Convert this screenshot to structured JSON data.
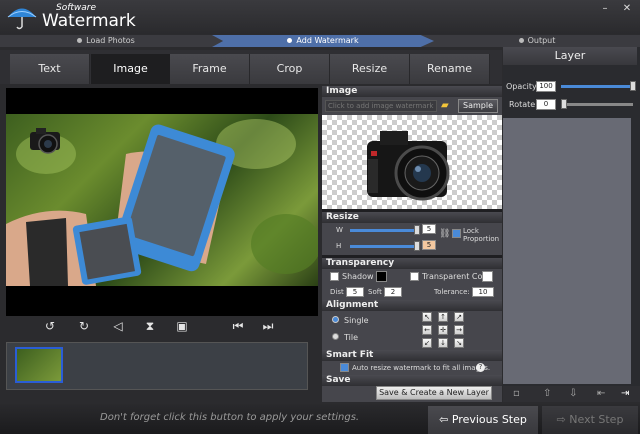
{
  "app": {
    "subtitle": "Software",
    "title": "Watermark"
  },
  "steps": [
    "Load Photos",
    "Add Watermark",
    "Output"
  ],
  "tabs": [
    "Text",
    "Image",
    "Frame",
    "Crop",
    "Resize",
    "Rename"
  ],
  "active_tab": "Image",
  "image_section": {
    "title": "Image",
    "path_placeholder": "Click to add image watermark...",
    "sample_label": "Sample"
  },
  "resize_section": {
    "title": "Resize",
    "w_label": "W",
    "h_label": "H",
    "w_value": "5",
    "h_value": "5",
    "lock_label": "Lock\nProportion"
  },
  "transparency_section": {
    "title": "Transparency",
    "shadow_label": "Shadow",
    "transparent_color_label": "Transparent Color",
    "dist_label": "Dist",
    "dist_value": "5",
    "soft_label": "Soft",
    "soft_value": "2",
    "tolerance_label": "Tolerance:",
    "tolerance_value": "10"
  },
  "alignment_section": {
    "title": "Alignment",
    "single_label": "Single",
    "tile_label": "Tile"
  },
  "smartfit_section": {
    "title": "Smart Fit",
    "auto_resize_label": "Auto resize watermark to fit all images."
  },
  "save_section": {
    "title": "Save",
    "button_label": "Save & Create a New Layer"
  },
  "layer_panel": {
    "title": "Layer",
    "opacity_label": "Opacity",
    "opacity_value": "100",
    "rotate_label": "Rotate",
    "rotate_value": "0"
  },
  "footer": {
    "hint": "Don't forget click this button to apply your settings.",
    "prev_label": "Previous Step",
    "next_label": "Next Step"
  },
  "colors": {
    "accent": "#4e6fa8",
    "slider": "#4a8ad8"
  }
}
